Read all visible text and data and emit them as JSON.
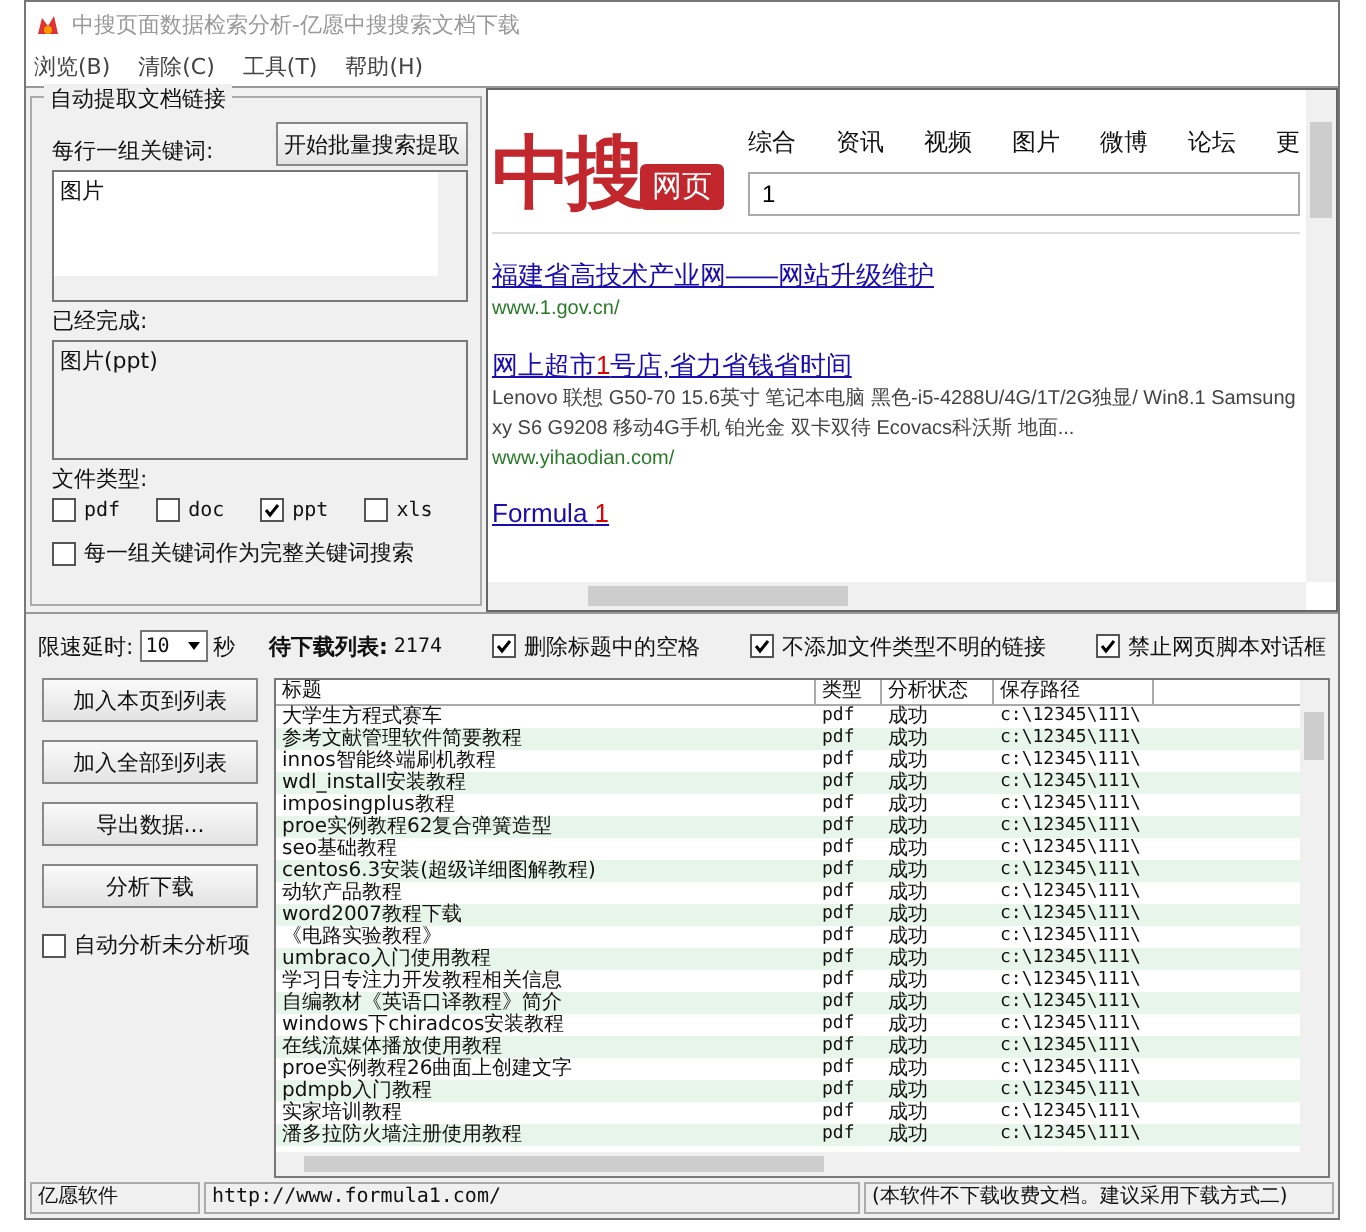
{
  "window": {
    "title": "中搜页面数据检索分析-亿愿中搜搜索文档下载"
  },
  "menu": [
    "浏览(B)",
    "清除(C)",
    "工具(T)",
    "帮助(H)"
  ],
  "extract_panel": {
    "legend": "自动提取文档链接",
    "keywords_label": "每行一组关键词:",
    "start_button": "开始批量搜索提取",
    "keywords": "图片",
    "done_label": "已经完成:",
    "done": "图片(ppt)",
    "filetype_label": "文件类型:",
    "filetypes": [
      {
        "label": "pdf",
        "checked": false
      },
      {
        "label": "doc",
        "checked": false
      },
      {
        "label": "ppt",
        "checked": true
      },
      {
        "label": "xls",
        "checked": false
      }
    ],
    "whole_keyword": {
      "label": "每一组关键词作为完整关键词搜索",
      "checked": false
    }
  },
  "browser": {
    "logo_main": "中搜",
    "logo_tag": "网页",
    "nav": [
      "综合",
      "资讯",
      "视频",
      "图片",
      "微博",
      "论坛",
      "更"
    ],
    "search_value": "1",
    "results": [
      {
        "title": [
          {
            "text": "福建省高技术产业网——网站升级维护",
            "highlight": false
          }
        ],
        "url": "www.1.gov.cn/"
      },
      {
        "title": [
          {
            "text": "网上超市",
            "highlight": false
          },
          {
            "text": "1",
            "highlight": true
          },
          {
            "text": "号店,省力省钱省时间",
            "highlight": false
          }
        ],
        "snippet": [
          "Lenovo 联想 G50-70 15.6英寸 笔记本电脑 黑色-i5-4288U/4G/1T/2G独显/ Win8.1 Samsung",
          "xy S6 G9208 移动4G手机 铂光金 双卡双待 Ecovacs科沃斯 地面..."
        ],
        "url": "www.yihaodian.com/"
      },
      {
        "title": [
          {
            "text": "Formula ",
            "highlight": false
          },
          {
            "text": "1",
            "highlight": true
          }
        ]
      }
    ]
  },
  "toolbar": {
    "delay_label": "限速延时:",
    "delay_value": "10",
    "delay_unit": "秒",
    "queue_label": "待下载列表:",
    "queue_count": "2174",
    "options": [
      {
        "label": "删除标题中的空格",
        "checked": true
      },
      {
        "label": "不添加文件类型不明的链接",
        "checked": true
      },
      {
        "label": "禁止网页脚本对话框",
        "checked": true
      }
    ]
  },
  "actions": [
    "加入本页到列表",
    "加入全部到列表",
    "导出数据...",
    "分析下载"
  ],
  "auto_analyze": {
    "label": "自动分析未分析项",
    "checked": false
  },
  "table": {
    "columns": [
      "标题",
      "类型",
      "分析状态",
      "保存路径"
    ],
    "rows": [
      [
        "大学生方程式赛车",
        "pdf",
        "成功",
        "c:\\12345\\111\\"
      ],
      [
        "参考文献管理软件简要教程",
        "pdf",
        "成功",
        "c:\\12345\\111\\"
      ],
      [
        "innos智能终端刷机教程",
        "pdf",
        "成功",
        "c:\\12345\\111\\"
      ],
      [
        "wdl_install安装教程",
        "pdf",
        "成功",
        "c:\\12345\\111\\"
      ],
      [
        "imposingplus教程",
        "pdf",
        "成功",
        "c:\\12345\\111\\"
      ],
      [
        "proe实例教程62复合弹簧造型",
        "pdf",
        "成功",
        "c:\\12345\\111\\"
      ],
      [
        "seo基础教程",
        "pdf",
        "成功",
        "c:\\12345\\111\\"
      ],
      [
        "centos6.3安装(超级详细图解教程)",
        "pdf",
        "成功",
        "c:\\12345\\111\\"
      ],
      [
        "动软产品教程",
        "pdf",
        "成功",
        "c:\\12345\\111\\"
      ],
      [
        "word2007教程下载",
        "pdf",
        "成功",
        "c:\\12345\\111\\"
      ],
      [
        "《电路实验教程》",
        "pdf",
        "成功",
        "c:\\12345\\111\\"
      ],
      [
        "umbraco入门使用教程",
        "pdf",
        "成功",
        "c:\\12345\\111\\"
      ],
      [
        "学习日专注力开发教程相关信息",
        "pdf",
        "成功",
        "c:\\12345\\111\\"
      ],
      [
        "自编教材《英语口译教程》简介",
        "pdf",
        "成功",
        "c:\\12345\\111\\"
      ],
      [
        "windows下chiradcos安装教程",
        "pdf",
        "成功",
        "c:\\12345\\111\\"
      ],
      [
        "在线流媒体播放使用教程",
        "pdf",
        "成功",
        "c:\\12345\\111\\"
      ],
      [
        "proe实例教程26曲面上创建文字",
        "pdf",
        "成功",
        "c:\\12345\\111\\"
      ],
      [
        "pdmpb入门教程",
        "pdf",
        "成功",
        "c:\\12345\\111\\"
      ],
      [
        "实家培训教程",
        "pdf",
        "成功",
        "c:\\12345\\111\\"
      ],
      [
        "潘多拉防火墙注册使用教程",
        "pdf",
        "成功",
        "c:\\12345\\111\\"
      ]
    ]
  },
  "status_bar": [
    "亿愿软件",
    "http://www.formula1.com/",
    "(本软件不下载收费文档。建议采用下载方式二)"
  ]
}
